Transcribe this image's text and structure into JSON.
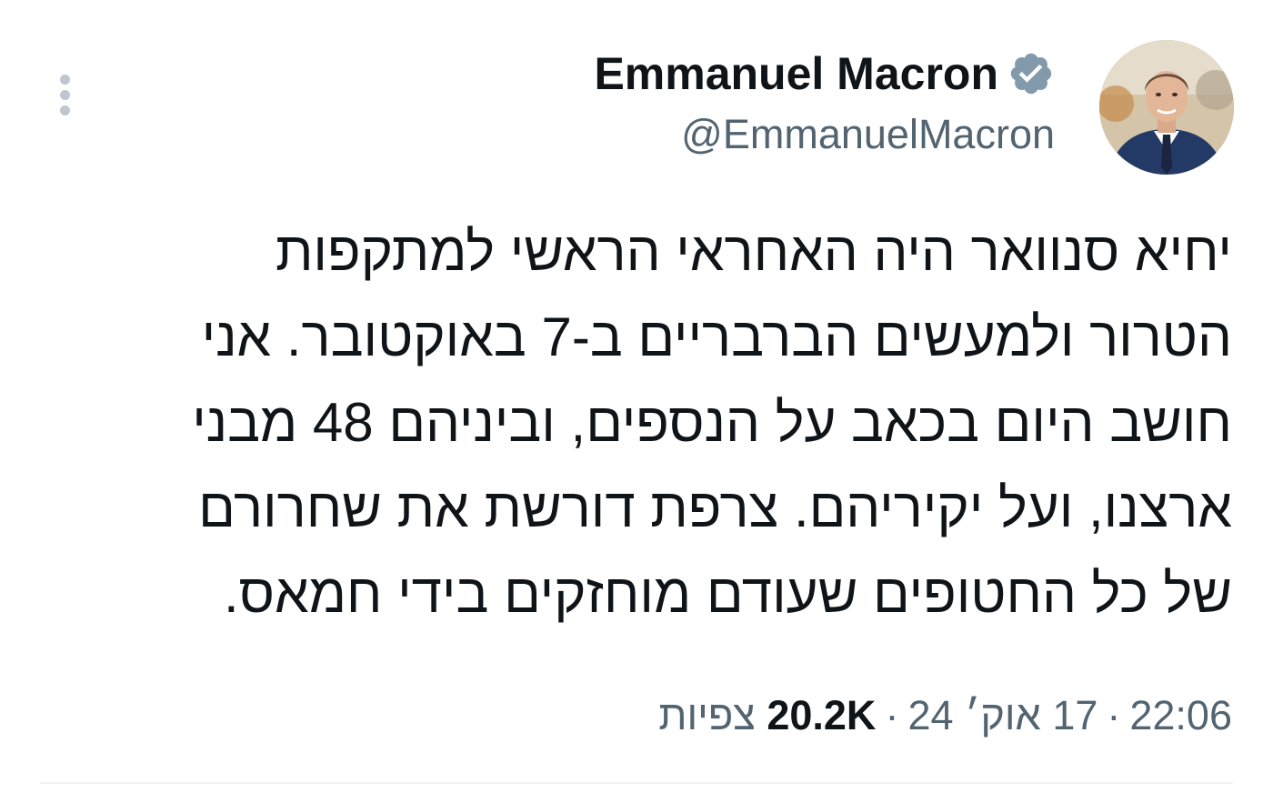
{
  "author": {
    "name": "Emmanuel Macron",
    "handle": "@EmmanuelMacron",
    "verified": true
  },
  "tweet": {
    "text_lines": [
      "יחיא סנוואר היה האחראי הראשי למתקפות",
      "הטרור ולמעשים הברבריים ב-7 באוקטובר. אני",
      "חושב היום בכאב על הנספים, וביניהם 48 מבני",
      "ארצנו, ועל יקיריהם. צרפת דורשת את שחרורם",
      "של כל החטופים שעודם מוחזקים בידי חמאס."
    ]
  },
  "meta": {
    "time": "22:06",
    "separator": "·",
    "date": "17 אוק׳ 24",
    "views_count": "20.2K",
    "views_label": "צפיות"
  },
  "icons": {
    "more": "more-vertical-icon",
    "verified": "verified-badge-icon"
  },
  "colors": {
    "text_primary": "#0f1419",
    "text_secondary": "#536471",
    "verified_badge": "#829aab",
    "divider": "#eff3f4"
  }
}
